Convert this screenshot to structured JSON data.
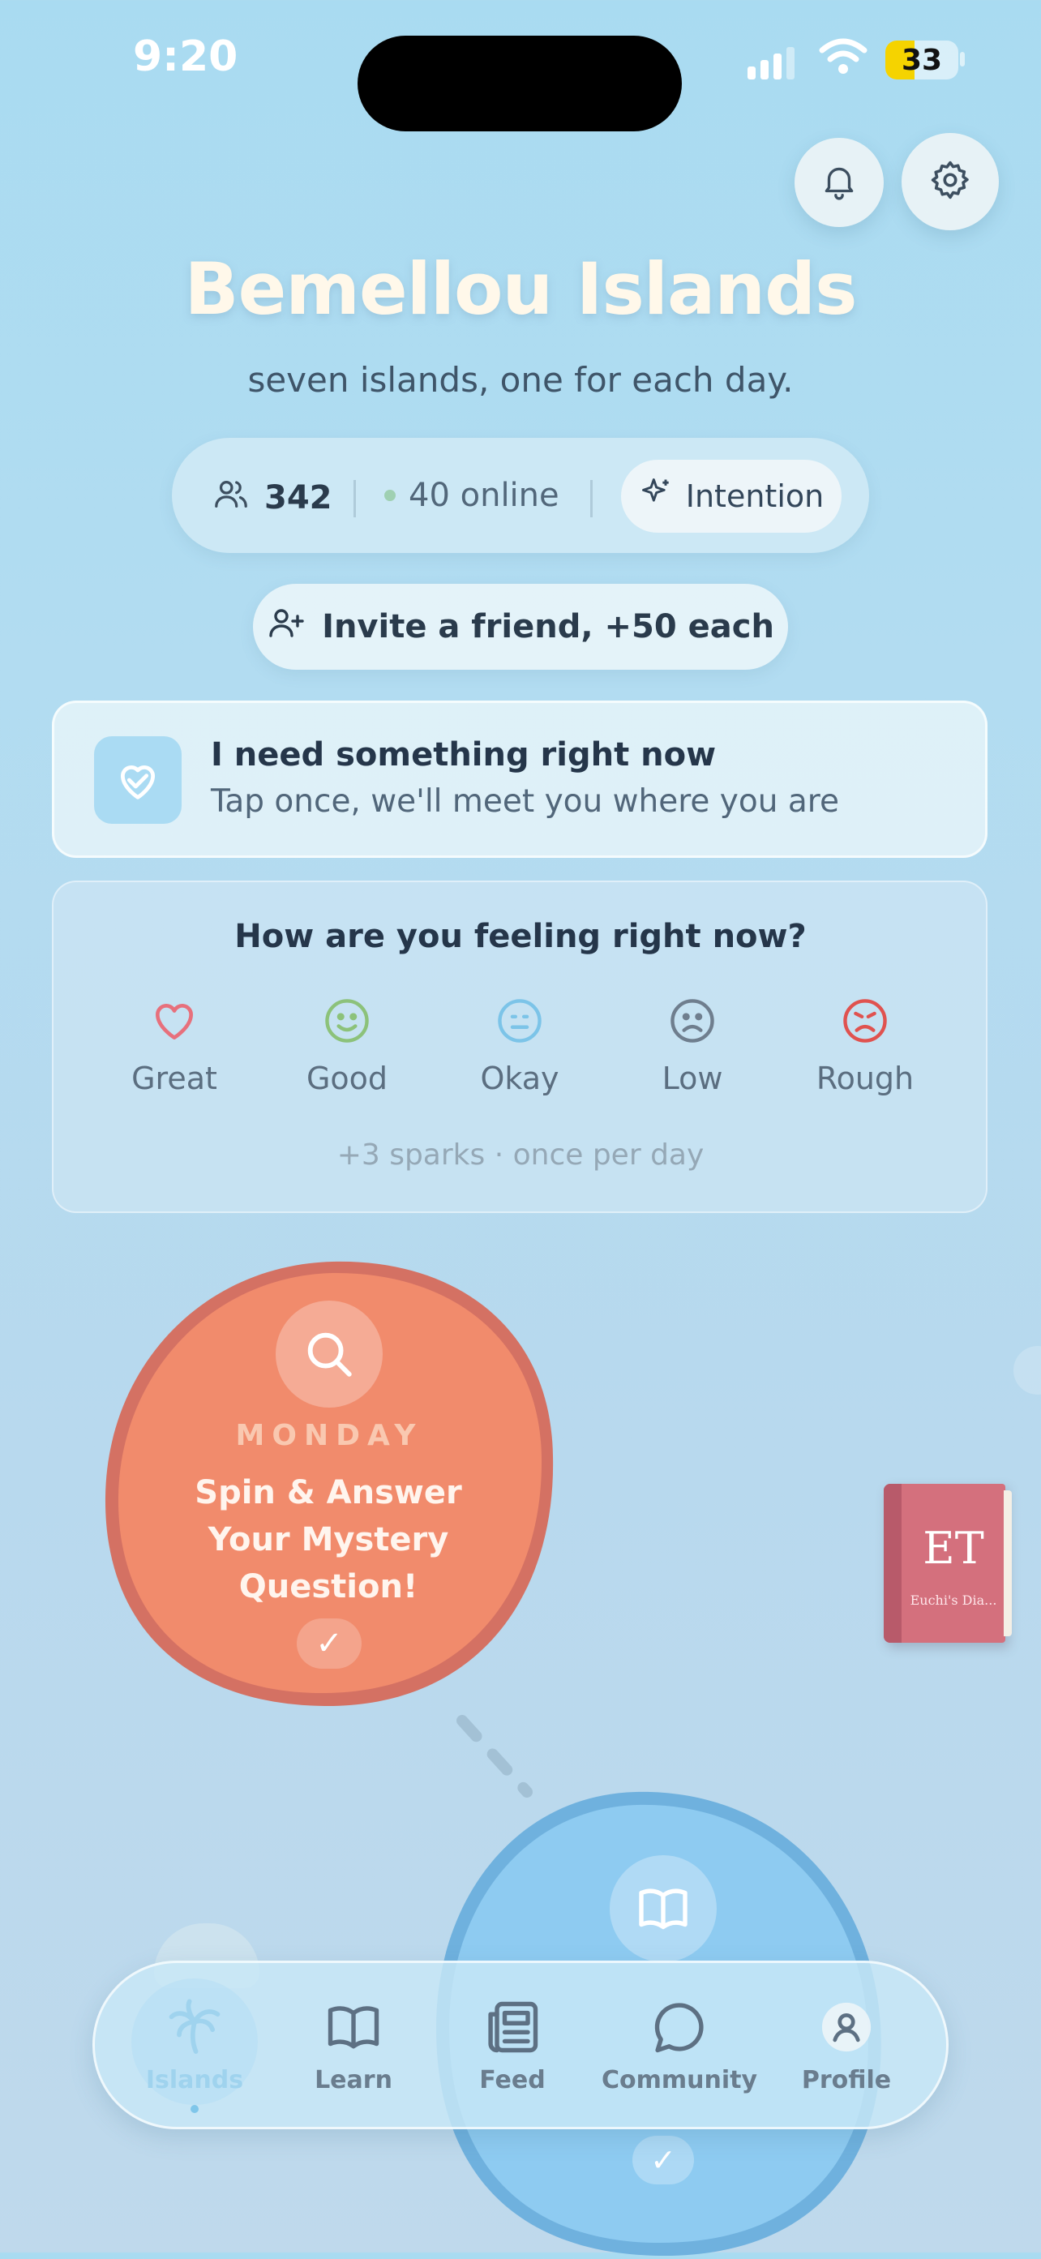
{
  "status_bar": {
    "time": "9:20",
    "battery": "33"
  },
  "header": {
    "title": "Bemellou Islands",
    "subtitle": "seven islands, one for each day."
  },
  "stats": {
    "members": "342",
    "online": "40 online",
    "intention_label": "Intention"
  },
  "invite": {
    "label": "Invite a friend, +50 each"
  },
  "need_card": {
    "title": "I need something right now",
    "subtitle": "Tap once, we'll meet you where you are"
  },
  "mood": {
    "question": "How are you feeling right now?",
    "options": [
      {
        "label": "Great",
        "icon": "heart-icon",
        "color": "#e7707c"
      },
      {
        "label": "Good",
        "icon": "smile-icon",
        "color": "#8cc27a"
      },
      {
        "label": "Okay",
        "icon": "neutral-face-icon",
        "color": "#7cc4e8"
      },
      {
        "label": "Low",
        "icon": "sad-face-icon",
        "color": "#6f7e8e"
      },
      {
        "label": "Rough",
        "icon": "angry-face-icon",
        "color": "#e0524f"
      }
    ],
    "sparks_note": "+3 sparks · once per day"
  },
  "islands": {
    "monday": {
      "day": "MONDAY",
      "title": "Spin & Answer Your Mystery Question!",
      "check": "✓",
      "color": "#f08a6a"
    },
    "tuesday": {
      "check": "✓",
      "color": "#8cc8ef"
    }
  },
  "journal": {
    "initials": "ET",
    "caption": "Euchi's Dia..."
  },
  "nav": {
    "items": [
      {
        "label": "Islands",
        "icon": "palm-tree-icon",
        "active": true
      },
      {
        "label": "Learn",
        "icon": "book-icon",
        "active": false
      },
      {
        "label": "Feed",
        "icon": "newspaper-icon",
        "active": false
      },
      {
        "label": "Community",
        "icon": "chat-bubble-icon",
        "active": false
      },
      {
        "label": "Profile",
        "icon": "person-icon",
        "active": false
      }
    ]
  }
}
